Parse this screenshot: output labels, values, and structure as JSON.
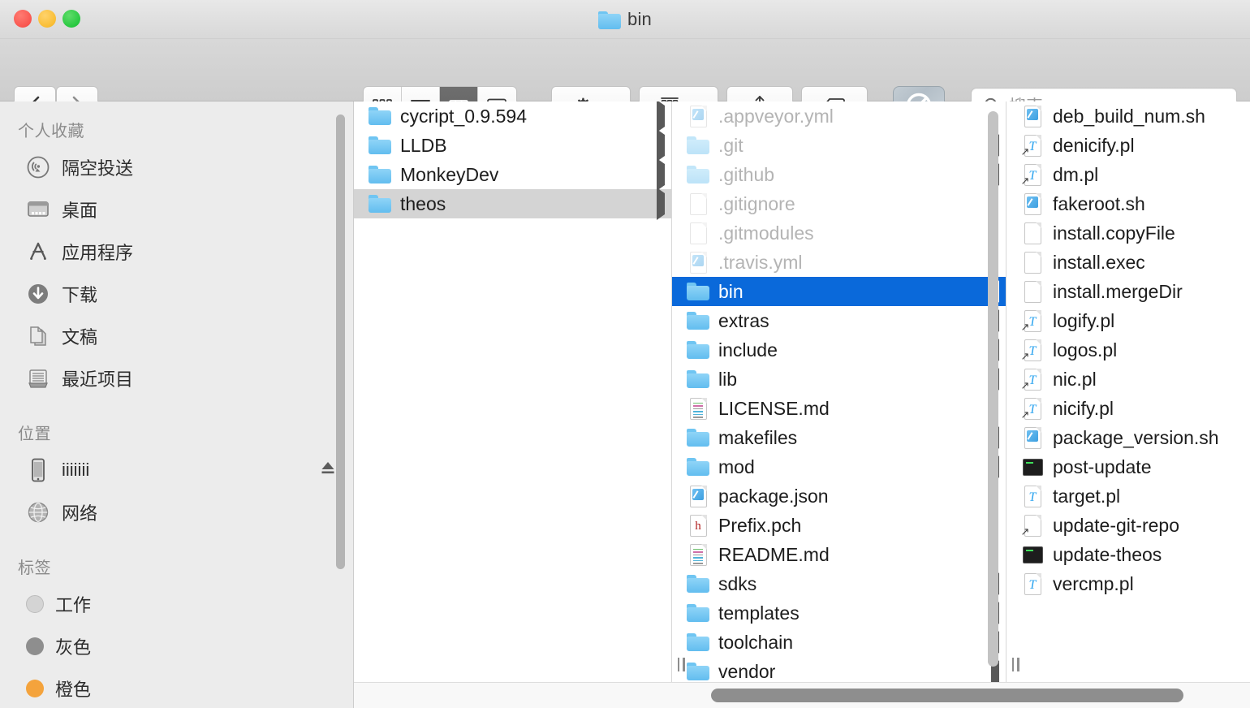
{
  "window": {
    "title": "bin",
    "title_icon": "folder-icon",
    "traffic_lights": [
      {
        "name": "close-button",
        "color": "#f9564f"
      },
      {
        "name": "minimize-button",
        "color": "#f9bd35"
      },
      {
        "name": "zoom-button",
        "color": "#28c840"
      }
    ]
  },
  "toolbar": {
    "back_label": "‹",
    "forward_label": "›",
    "view_modes": [
      {
        "name": "icon-view",
        "icon": "grid-icon",
        "active": false
      },
      {
        "name": "list-view",
        "icon": "list-icon",
        "active": false
      },
      {
        "name": "column-view",
        "icon": "columns-icon",
        "active": true
      },
      {
        "name": "gallery-view",
        "icon": "gallery-icon",
        "active": false
      }
    ],
    "action_button": {
      "name": "action-gear-button",
      "icon": "gear-icon"
    },
    "arrange_button": {
      "name": "arrange-button",
      "icon": "arrange-grid-icon"
    },
    "share_button": {
      "name": "share-button",
      "icon": "share-upload-icon"
    },
    "tag_button": {
      "name": "tag-button",
      "icon": "tag-icon"
    },
    "dropbox_button": {
      "name": "dropbox-sync-button",
      "icon": "prohibited-icon"
    },
    "search": {
      "placeholder": "搜索",
      "value": "",
      "icon": "search-icon"
    }
  },
  "sidebar": {
    "sections": [
      {
        "header": "个人收藏",
        "items": [
          {
            "label": "隔空投送",
            "icon": "airdrop-icon"
          },
          {
            "label": "桌面",
            "icon": "desktop-icon"
          },
          {
            "label": "应用程序",
            "icon": "applications-icon"
          },
          {
            "label": "下载",
            "icon": "downloads-icon"
          },
          {
            "label": "文稿",
            "icon": "documents-icon"
          },
          {
            "label": "最近项目",
            "icon": "recents-icon"
          }
        ]
      },
      {
        "header": "位置",
        "items": [
          {
            "label": "iiiiiii",
            "icon": "iphone-icon",
            "eject": true
          },
          {
            "label": "网络",
            "icon": "network-globe-icon"
          }
        ]
      },
      {
        "header": "标签",
        "items": [
          {
            "label": "工作",
            "icon": "tag-dot-icon",
            "color": "#d4d4d4"
          },
          {
            "label": "灰色",
            "icon": "tag-dot-icon",
            "color": "#8e8e8e"
          },
          {
            "label": "橙色",
            "icon": "tag-dot-icon",
            "color": "#f4a33c"
          }
        ]
      }
    ]
  },
  "browser": {
    "column1": {
      "name": "column-parent",
      "items": [
        {
          "label": "cycript_0.9.594",
          "icon": "folder-icon",
          "disclosure": true,
          "selected": false,
          "dim": false
        },
        {
          "label": "LLDB",
          "icon": "folder-icon",
          "disclosure": true,
          "selected": false,
          "dim": false
        },
        {
          "label": "MonkeyDev",
          "icon": "folder-icon",
          "disclosure": true,
          "selected": false,
          "dim": false
        },
        {
          "label": "theos",
          "icon": "folder-icon",
          "disclosure": true,
          "selected": "gray",
          "dim": false
        }
      ]
    },
    "column2": {
      "name": "column-theos",
      "items": [
        {
          "label": ".appveyor.yml",
          "icon": "script-doc-icon",
          "disclosure": false,
          "selected": false,
          "dim": true
        },
        {
          "label": ".git",
          "icon": "folder-icon",
          "disclosure": true,
          "selected": false,
          "dim": true
        },
        {
          "label": ".github",
          "icon": "folder-icon",
          "disclosure": true,
          "selected": false,
          "dim": true
        },
        {
          "label": ".gitignore",
          "icon": "blank-doc-icon",
          "disclosure": false,
          "selected": false,
          "dim": true
        },
        {
          "label": ".gitmodules",
          "icon": "blank-doc-icon",
          "disclosure": false,
          "selected": false,
          "dim": true
        },
        {
          "label": ".travis.yml",
          "icon": "script-doc-icon",
          "disclosure": false,
          "selected": false,
          "dim": true
        },
        {
          "label": "bin",
          "icon": "folder-icon",
          "disclosure": true,
          "selected": "blue",
          "dim": false
        },
        {
          "label": "extras",
          "icon": "folder-icon",
          "disclosure": true,
          "selected": false,
          "dim": false
        },
        {
          "label": "include",
          "icon": "folder-icon",
          "disclosure": true,
          "selected": false,
          "dim": false
        },
        {
          "label": "lib",
          "icon": "folder-icon",
          "disclosure": true,
          "selected": false,
          "dim": false
        },
        {
          "label": "LICENSE.md",
          "icon": "markdown-doc-icon",
          "disclosure": false,
          "selected": false,
          "dim": false
        },
        {
          "label": "makefiles",
          "icon": "folder-icon",
          "disclosure": true,
          "selected": false,
          "dim": false
        },
        {
          "label": "mod",
          "icon": "folder-icon",
          "disclosure": true,
          "selected": false,
          "dim": false
        },
        {
          "label": "package.json",
          "icon": "script-doc-icon",
          "disclosure": false,
          "selected": false,
          "dim": false
        },
        {
          "label": "Prefix.pch",
          "icon": "header-doc-icon",
          "disclosure": false,
          "selected": false,
          "dim": false
        },
        {
          "label": "README.md",
          "icon": "markdown-doc-icon",
          "disclosure": false,
          "selected": false,
          "dim": false
        },
        {
          "label": "sdks",
          "icon": "folder-icon",
          "disclosure": true,
          "selected": false,
          "dim": false
        },
        {
          "label": "templates",
          "icon": "folder-icon",
          "disclosure": true,
          "selected": false,
          "dim": false
        },
        {
          "label": "toolchain",
          "icon": "folder-icon",
          "disclosure": true,
          "selected": false,
          "dim": false
        },
        {
          "label": "vendor",
          "icon": "folder-icon",
          "disclosure": true,
          "selected": false,
          "dim": false
        }
      ]
    },
    "column3": {
      "name": "column-bin",
      "items": [
        {
          "label": "deb_build_num.sh",
          "icon": "script-doc-icon",
          "disclosure": false,
          "selected": false,
          "dim": false
        },
        {
          "label": "denicify.pl",
          "icon": "perl-alias-doc-icon",
          "disclosure": false,
          "selected": false,
          "dim": false
        },
        {
          "label": "dm.pl",
          "icon": "perl-alias-doc-icon",
          "disclosure": false,
          "selected": false,
          "dim": false
        },
        {
          "label": "fakeroot.sh",
          "icon": "script-doc-icon",
          "disclosure": false,
          "selected": false,
          "dim": false
        },
        {
          "label": "install.copyFile",
          "icon": "blank-doc-icon",
          "disclosure": false,
          "selected": false,
          "dim": false
        },
        {
          "label": "install.exec",
          "icon": "blank-doc-icon",
          "disclosure": false,
          "selected": false,
          "dim": false
        },
        {
          "label": "install.mergeDir",
          "icon": "blank-doc-icon",
          "disclosure": false,
          "selected": false,
          "dim": false
        },
        {
          "label": "logify.pl",
          "icon": "perl-alias-doc-icon",
          "disclosure": false,
          "selected": false,
          "dim": false
        },
        {
          "label": "logos.pl",
          "icon": "perl-alias-doc-icon",
          "disclosure": false,
          "selected": false,
          "dim": false
        },
        {
          "label": "nic.pl",
          "icon": "perl-alias-doc-icon",
          "disclosure": false,
          "selected": false,
          "dim": false
        },
        {
          "label": "nicify.pl",
          "icon": "perl-alias-doc-icon",
          "disclosure": false,
          "selected": false,
          "dim": false
        },
        {
          "label": "package_version.sh",
          "icon": "script-doc-icon",
          "disclosure": false,
          "selected": false,
          "dim": false
        },
        {
          "label": "post-update",
          "icon": "terminal-exec-icon",
          "disclosure": false,
          "selected": false,
          "dim": false
        },
        {
          "label": "target.pl",
          "icon": "perl-doc-icon",
          "disclosure": false,
          "selected": false,
          "dim": false
        },
        {
          "label": "update-git-repo",
          "icon": "alias-doc-icon",
          "disclosure": false,
          "selected": false,
          "dim": false
        },
        {
          "label": "update-theos",
          "icon": "terminal-exec-icon",
          "disclosure": false,
          "selected": false,
          "dim": false
        },
        {
          "label": "vercmp.pl",
          "icon": "perl-doc-icon",
          "disclosure": false,
          "selected": false,
          "dim": false
        }
      ]
    }
  }
}
